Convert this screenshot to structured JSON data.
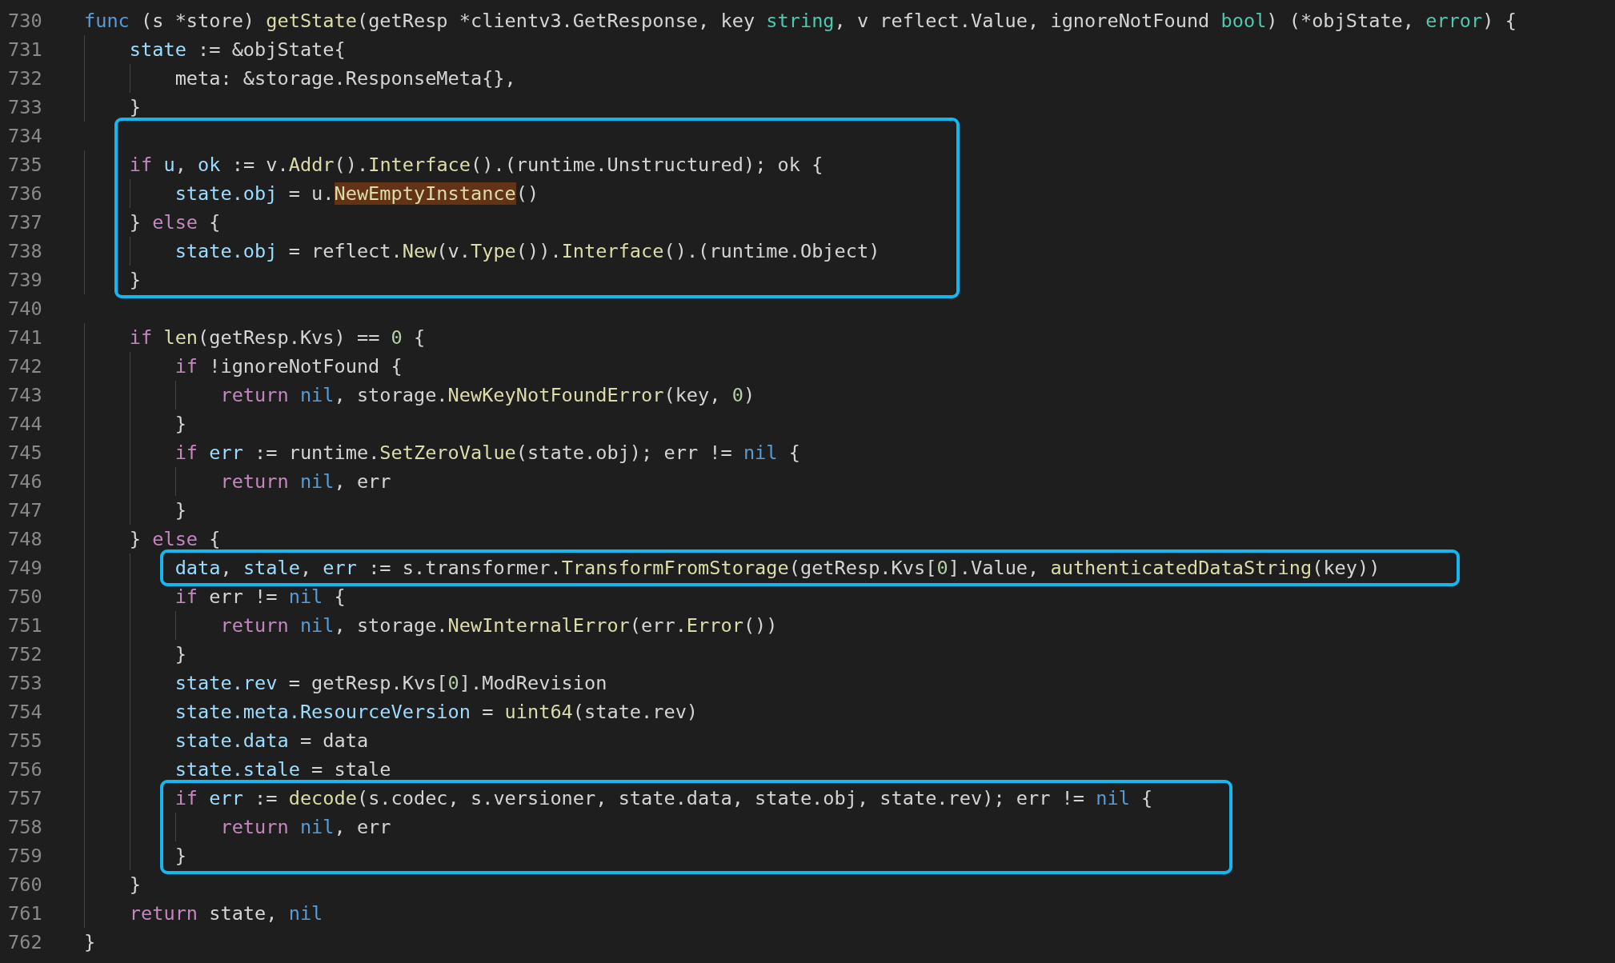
{
  "blocks": [
    {
      "boxed": false,
      "lines": [
        {
          "number": "730",
          "tokens": [
            {
              "kind": "decl",
              "text": "func"
            },
            {
              "kind": "plain",
              "text": " (s *store) "
            },
            {
              "kind": "fn",
              "text": "getState"
            },
            {
              "kind": "plain",
              "text": "(getResp *clientv3.GetResponse, key "
            },
            {
              "kind": "type",
              "text": "string"
            },
            {
              "kind": "plain",
              "text": ", v reflect.Value, ignoreNotFound "
            },
            {
              "kind": "type",
              "text": "bool"
            },
            {
              "kind": "plain",
              "text": ") (*objState, "
            },
            {
              "kind": "type",
              "text": "error"
            },
            {
              "kind": "plain",
              "text": ") {"
            }
          ]
        },
        {
          "number": "731",
          "tokens": [
            {
              "kind": "var",
              "text": "    state"
            },
            {
              "kind": "plain",
              "text": " := &objState{"
            }
          ]
        },
        {
          "number": "732",
          "tokens": [
            {
              "kind": "plain",
              "text": "        meta: &storage.ResponseMeta{},"
            }
          ]
        },
        {
          "number": "733",
          "tokens": [
            {
              "kind": "plain",
              "text": "    }"
            }
          ]
        }
      ]
    },
    {
      "boxed": true,
      "lines": [
        {
          "number": "734"
        },
        {
          "number": "735",
          "tokens": [
            {
              "kind": "kw",
              "text": "    if "
            },
            {
              "kind": "var",
              "text": "u"
            },
            {
              "kind": "plain",
              "text": ", "
            },
            {
              "kind": "var",
              "text": "ok"
            },
            {
              "kind": "plain",
              "text": " := v."
            },
            {
              "kind": "fn",
              "text": "Addr"
            },
            {
              "kind": "plain",
              "text": "()."
            },
            {
              "kind": "fn",
              "text": "Interface"
            },
            {
              "kind": "plain",
              "text": "().(runtime.Unstructured); ok {"
            }
          ]
        },
        {
          "number": "736",
          "tokens": [
            {
              "kind": "var",
              "text": "        state.obj"
            },
            {
              "kind": "plain",
              "text": " = u."
            },
            {
              "kind": "fn",
              "text": "NewEmptyInstance",
              "highlighted": true
            },
            {
              "kind": "plain",
              "text": "()"
            }
          ]
        },
        {
          "number": "737",
          "tokens": [
            {
              "kind": "plain",
              "text": "    } "
            },
            {
              "kind": "kw",
              "text": "else"
            },
            {
              "kind": "plain",
              "text": " {"
            }
          ]
        },
        {
          "number": "738",
          "tokens": [
            {
              "kind": "var",
              "text": "        state.obj"
            },
            {
              "kind": "plain",
              "text": " = reflect."
            },
            {
              "kind": "fn",
              "text": "New"
            },
            {
              "kind": "plain",
              "text": "(v."
            },
            {
              "kind": "fn",
              "text": "Type"
            },
            {
              "kind": "plain",
              "text": "())."
            },
            {
              "kind": "fn",
              "text": "Interface"
            },
            {
              "kind": "plain",
              "text": "().(runtime.Object)"
            }
          ]
        },
        {
          "number": "739",
          "tokens": [
            {
              "kind": "plain",
              "text": "    }"
            }
          ]
        }
      ]
    },
    {
      "boxed": false,
      "lines": [
        {
          "number": "740"
        },
        {
          "number": "741",
          "tokens": [
            {
              "kind": "kw",
              "text": "    if "
            },
            {
              "kind": "fn",
              "text": "len"
            },
            {
              "kind": "plain",
              "text": "(getResp.Kvs) == "
            },
            {
              "kind": "num",
              "text": "0"
            },
            {
              "kind": "plain",
              "text": " {"
            }
          ]
        },
        {
          "number": "742",
          "tokens": [
            {
              "kind": "kw",
              "text": "        if"
            },
            {
              "kind": "plain",
              "text": " !ignoreNotFound {"
            }
          ]
        },
        {
          "number": "743",
          "tokens": [
            {
              "kind": "kw",
              "text": "            return "
            },
            {
              "kind": "decl",
              "text": "nil"
            },
            {
              "kind": "plain",
              "text": ", storage."
            },
            {
              "kind": "fn",
              "text": "NewKeyNotFoundError"
            },
            {
              "kind": "plain",
              "text": "(key, "
            },
            {
              "kind": "num",
              "text": "0"
            },
            {
              "kind": "plain",
              "text": ")"
            }
          ]
        },
        {
          "number": "744",
          "tokens": [
            {
              "kind": "plain",
              "text": "        }"
            }
          ]
        },
        {
          "number": "745",
          "tokens": [
            {
              "kind": "kw",
              "text": "        if "
            },
            {
              "kind": "var",
              "text": "err"
            },
            {
              "kind": "plain",
              "text": " := runtime."
            },
            {
              "kind": "fn",
              "text": "SetZeroValue"
            },
            {
              "kind": "plain",
              "text": "(state.obj); err != "
            },
            {
              "kind": "decl",
              "text": "nil"
            },
            {
              "kind": "plain",
              "text": " {"
            }
          ]
        },
        {
          "number": "746",
          "tokens": [
            {
              "kind": "kw",
              "text": "            return "
            },
            {
              "kind": "decl",
              "text": "nil"
            },
            {
              "kind": "plain",
              "text": ", err"
            }
          ]
        },
        {
          "number": "747",
          "tokens": [
            {
              "kind": "plain",
              "text": "        }"
            }
          ]
        },
        {
          "number": "748",
          "tokens": [
            {
              "kind": "plain",
              "text": "    } "
            },
            {
              "kind": "kw",
              "text": "else"
            },
            {
              "kind": "plain",
              "text": " {"
            }
          ]
        }
      ]
    },
    {
      "boxed": true,
      "lines": [
        {
          "number": "749",
          "tokens": [
            {
              "kind": "var",
              "text": "        data"
            },
            {
              "kind": "plain",
              "text": ", "
            },
            {
              "kind": "var",
              "text": "stale"
            },
            {
              "kind": "plain",
              "text": ", "
            },
            {
              "kind": "var",
              "text": "err"
            },
            {
              "kind": "plain",
              "text": " := s.transformer."
            },
            {
              "kind": "fn",
              "text": "TransformFromStorage"
            },
            {
              "kind": "plain",
              "text": "(getResp.Kvs["
            },
            {
              "kind": "num",
              "text": "0"
            },
            {
              "kind": "plain",
              "text": "].Value, "
            },
            {
              "kind": "fn",
              "text": "authenticatedDataString"
            },
            {
              "kind": "plain",
              "text": "(key))"
            }
          ]
        }
      ]
    },
    {
      "boxed": false,
      "lines": [
        {
          "number": "750",
          "tokens": [
            {
              "kind": "kw",
              "text": "        if"
            },
            {
              "kind": "plain",
              "text": " err != "
            },
            {
              "kind": "decl",
              "text": "nil"
            },
            {
              "kind": "plain",
              "text": " {"
            }
          ]
        },
        {
          "number": "751",
          "tokens": [
            {
              "kind": "kw",
              "text": "            return "
            },
            {
              "kind": "decl",
              "text": "nil"
            },
            {
              "kind": "plain",
              "text": ", storage."
            },
            {
              "kind": "fn",
              "text": "NewInternalError"
            },
            {
              "kind": "plain",
              "text": "(err."
            },
            {
              "kind": "fn",
              "text": "Error"
            },
            {
              "kind": "plain",
              "text": "())"
            }
          ]
        },
        {
          "number": "752",
          "tokens": [
            {
              "kind": "plain",
              "text": "        }"
            }
          ]
        },
        {
          "number": "753",
          "tokens": [
            {
              "kind": "var",
              "text": "        state.rev"
            },
            {
              "kind": "plain",
              "text": " = getResp.Kvs["
            },
            {
              "kind": "num",
              "text": "0"
            },
            {
              "kind": "plain",
              "text": "].ModRevision"
            }
          ]
        },
        {
          "number": "754",
          "tokens": [
            {
              "kind": "var",
              "text": "        state.meta.ResourceVersion"
            },
            {
              "kind": "plain",
              "text": " = "
            },
            {
              "kind": "fn",
              "text": "uint64"
            },
            {
              "kind": "plain",
              "text": "(state.rev)"
            }
          ]
        },
        {
          "number": "755",
          "tokens": [
            {
              "kind": "var",
              "text": "        state.data"
            },
            {
              "kind": "plain",
              "text": " = data"
            }
          ]
        },
        {
          "number": "756",
          "tokens": [
            {
              "kind": "var",
              "text": "        state.stale"
            },
            {
              "kind": "plain",
              "text": " = stale"
            }
          ]
        }
      ]
    },
    {
      "boxed": true,
      "lines": [
        {
          "number": "757",
          "tokens": [
            {
              "kind": "kw",
              "text": "        if "
            },
            {
              "kind": "var",
              "text": "err"
            },
            {
              "kind": "plain",
              "text": " := "
            },
            {
              "kind": "fn",
              "text": "decode"
            },
            {
              "kind": "plain",
              "text": "(s.codec, s.versioner, state.data, state.obj, state.rev); err != "
            },
            {
              "kind": "decl",
              "text": "nil"
            },
            {
              "kind": "plain",
              "text": " {"
            }
          ]
        },
        {
          "number": "758",
          "tokens": [
            {
              "kind": "kw",
              "text": "            return "
            },
            {
              "kind": "decl",
              "text": "nil"
            },
            {
              "kind": "plain",
              "text": ", err"
            }
          ]
        },
        {
          "number": "759",
          "tokens": [
            {
              "kind": "plain",
              "text": "        }"
            }
          ]
        }
      ]
    },
    {
      "boxed": false,
      "lines": [
        {
          "number": "760",
          "tokens": [
            {
              "kind": "plain",
              "text": "    }"
            }
          ]
        },
        {
          "number": "761",
          "tokens": [
            {
              "kind": "kw",
              "text": "    return"
            },
            {
              "kind": "plain",
              "text": " state, "
            },
            {
              "kind": "decl",
              "text": "nil"
            }
          ]
        },
        {
          "number": "762",
          "tokens": [
            {
              "kind": "plain",
              "text": "}"
            }
          ]
        }
      ]
    }
  ]
}
